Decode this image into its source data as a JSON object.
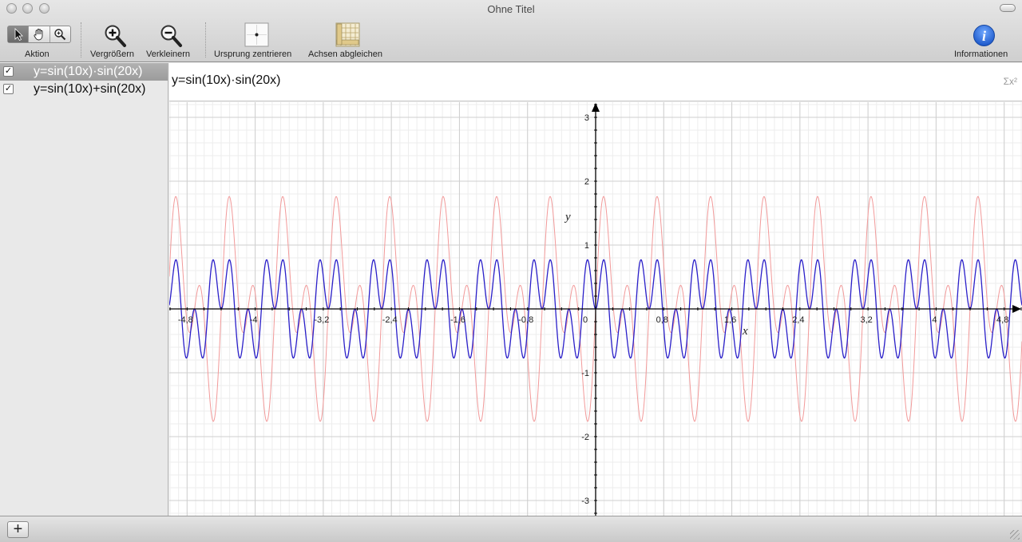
{
  "window": {
    "title": "Ohne Titel"
  },
  "toolbar": {
    "action_label": "Aktion",
    "zoom_in_label": "Vergrößern",
    "zoom_out_label": "Verkleinern",
    "center_origin_label": "Ursprung zentrieren",
    "equalize_axes_label": "Achsen abgleichen",
    "info_label": "Informationen",
    "action_tools": [
      "arrow-icon",
      "hand-icon",
      "magnifier-icon"
    ],
    "active_tool": "arrow-icon"
  },
  "sidebar": {
    "equations": [
      {
        "text": "y=sin(10x)·sin(20x)",
        "checked": true,
        "selected": true,
        "color": "#2a1fc9"
      },
      {
        "text": "y=sin(10x)+sin(20x)",
        "checked": true,
        "selected": false,
        "color": "#f08a8a"
      }
    ]
  },
  "formula_bar": {
    "text": "y=sin(10x)·sin(20x)",
    "sigma_button": "Σx²"
  },
  "chart_data": {
    "type": "line",
    "x": {
      "label": "x",
      "range": [
        -4.95,
        4.95
      ],
      "tick_labels": [
        "-4,8",
        "-4",
        "-3,2",
        "-2,4",
        "-1,6",
        "-0,8",
        "0",
        "0,8",
        "1,6",
        "2,4",
        "3,2",
        "4",
        "4,8"
      ],
      "ticks": [
        -4.8,
        -4.0,
        -3.2,
        -2.4,
        -1.6,
        -0.8,
        0,
        0.8,
        1.6,
        2.4,
        3.2,
        4.0,
        4.8
      ]
    },
    "y": {
      "label": "y",
      "range": [
        -3.2,
        3.2
      ],
      "tick_labels": [
        "-3",
        "-2",
        "-1",
        "1",
        "2",
        "3"
      ],
      "ticks": [
        -3,
        -2,
        -1,
        1,
        2,
        3
      ]
    },
    "grid": true,
    "series": [
      {
        "name": "y=sin(10x)·sin(20x)",
        "expression": "sin(10x)*sin(20x)",
        "color": "#2a1fc9"
      },
      {
        "name": "y=sin(10x)+sin(20x)",
        "expression": "sin(10x)+sin(20x)",
        "color": "#f29a9a"
      }
    ]
  },
  "bottombar": {
    "add_label": "+"
  }
}
